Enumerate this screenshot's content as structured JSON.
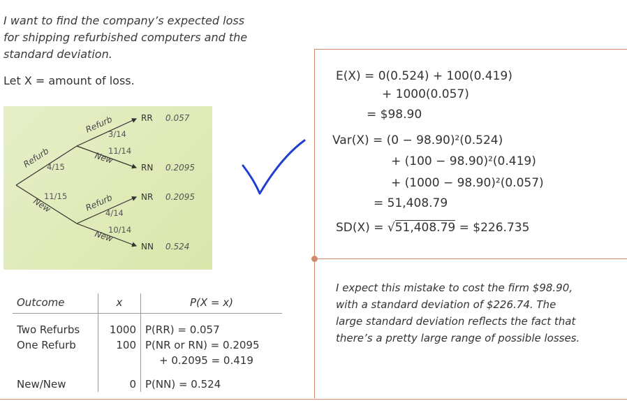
{
  "intro": {
    "line1": "I want to find the company’s expected loss",
    "line2": "for shipping refurbished computers and the",
    "line3": "standard deviation."
  },
  "letx": "Let X = amount of loss.",
  "tree": {
    "branch_refurb": "Refurb",
    "branch_new": "New",
    "p_first_refurb": "4/15",
    "p_first_new": "11/15",
    "p_rr": "3/14",
    "p_rn": "11/14",
    "p_nr": "4/14",
    "p_nn": "10/14",
    "leaf_rr": "RR",
    "leaf_rn": "RN",
    "leaf_nr": "NR",
    "leaf_nn": "NN",
    "prob_rr": "0.057",
    "prob_rn": "0.2095",
    "prob_nr": "0.2095",
    "prob_nn": "0.524"
  },
  "calc": {
    "ex_line1": "E(X) = 0(0.524) + 100(0.419)",
    "ex_line2": "+ 1000(0.057)",
    "ex_line3": "= $98.90",
    "var_line1": "Var(X) = (0 − 98.90)²(0.524)",
    "var_line2": "+ (100 − 98.90)²(0.419)",
    "var_line3": "+ (1000 − 98.90)²(0.057)",
    "var_line4": "= 51,408.79",
    "sd_prefix": "SD(X) = ",
    "sd_radicand": "51,408.79",
    "sd_result": " = $226.735"
  },
  "conclusion": {
    "line1": "I expect this mistake to cost the firm $98.90,",
    "line2": "with a standard deviation of $226.74. The",
    "line3": "large standard deviation reflects the fact that",
    "line4": "there’s a pretty large range of possible losses."
  },
  "table": {
    "h_outcome": "Outcome",
    "h_x": "x",
    "h_p": "P(X = x)",
    "rows": [
      {
        "outcome": "Two Refurbs",
        "x": "1000",
        "p": "P(RR) = 0.057"
      },
      {
        "outcome": "One Refurb",
        "x": "100",
        "p": "P(NR or RN) = 0.2095"
      },
      {
        "outcome": "",
        "x": "",
        "p": "+ 0.2095 = 0.419"
      },
      {
        "outcome": "New/New",
        "x": "0",
        "p": "P(NN) = 0.524"
      }
    ]
  },
  "colors": {
    "rule": "#d08a6a",
    "check": "#1f3fd0",
    "tree_bg": "#e3ecc0"
  }
}
